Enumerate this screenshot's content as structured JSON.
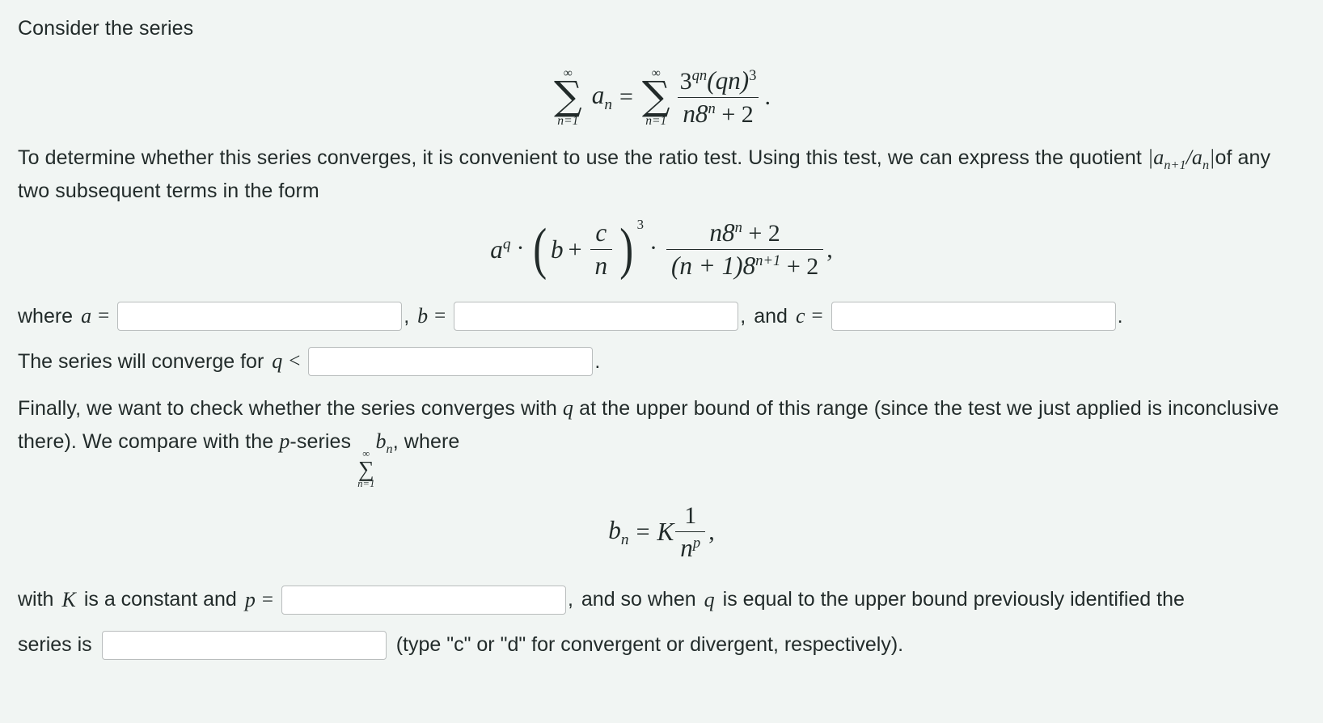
{
  "problem": {
    "intro": "Consider the series",
    "series_display": {
      "sum_limit_top": "∞",
      "sum_limit_bottom": "n=1",
      "term_symbol": "a",
      "term_index": "n",
      "equals": "=",
      "numerator_base": "3",
      "numerator_exponent": "qn",
      "numerator_paren": "(qn)",
      "numerator_paren_power": "3",
      "denominator": "n8",
      "denominator_exponent": "n",
      "denominator_tail": "+ 2",
      "trailing_punct": "."
    },
    "paragraph_ratio_test_1": "To determine whether this series converges, it is convenient to use the ratio test. Using this test, we can express the quotient",
    "paragraph_ratio_test_quotient_left": "|",
    "paragraph_ratio_test_quotient_a1": "a",
    "paragraph_ratio_test_quotient_sub1": "n+1",
    "paragraph_ratio_test_quotient_slash": "/",
    "paragraph_ratio_test_quotient_a2": "a",
    "paragraph_ratio_test_quotient_sub2": "n",
    "paragraph_ratio_test_quotient_right": "|",
    "paragraph_ratio_test_2": "of any two subsequent terms in the form",
    "quotient_display": {
      "a": "a",
      "a_exp": "q",
      "dot1": "·",
      "paren_open": "(",
      "b": "b",
      "plus": "+",
      "c": "c",
      "over_n": "n",
      "paren_close": ")",
      "paren_power": "3",
      "dot2": "·",
      "frac_num_n8": "n8",
      "frac_num_exp": "n",
      "frac_num_tail": "+ 2",
      "frac_den_paren": "(n + 1)8",
      "frac_den_exp": "n+1",
      "frac_den_tail": "+ 2",
      "trailing_punct": ","
    },
    "answers_line_1": {
      "where_label": "where",
      "a_symbol": "a",
      "a_equals": "=",
      "a_value": "",
      "comma_1": ",",
      "b_symbol": "b",
      "b_equals": "=",
      "b_value": "",
      "comma_2": ",",
      "and_label": "and",
      "c_symbol": "c",
      "c_equals": "=",
      "c_value": "",
      "period": "."
    },
    "converge_line": {
      "text": "The series will converge for",
      "q_symbol": "q",
      "less_than": "<",
      "q_value": "",
      "period": "."
    },
    "paragraph_final_1": "Finally, we want to check whether the series converges with",
    "paragraph_final_q": "q",
    "paragraph_final_2": "at the upper bound of this range (since the test we just applied is inconclusive there). We compare with the",
    "paragraph_final_p": "p",
    "paragraph_final_3": "-series",
    "pseries_inline": {
      "top": "∞",
      "bottom": "n=1",
      "term": "b",
      "term_index": "n",
      "comma": ","
    },
    "paragraph_final_4": "where",
    "bn_display": {
      "b": "b",
      "b_index": "n",
      "equals": "=",
      "K": "K",
      "frac_num": "1",
      "frac_den": "n",
      "frac_den_exp": "p",
      "trailing_punct": ","
    },
    "answers_line_2": {
      "with_label": "with",
      "K_symbol": "K",
      "is_constant_label": "is a constant and",
      "p_symbol": "p",
      "p_equals": "=",
      "p_value": "",
      "comma": ",",
      "tail_1": "and so when",
      "q_symbol": "q",
      "tail_2": "is equal to the upper bound previously identified the"
    },
    "answers_line_3": {
      "series_is_label": "series is",
      "series_value": "",
      "hint": "(type \"c\" or \"d\" for convergent or divergent, respectively)."
    }
  },
  "colors": {
    "background": "#f1f5f3",
    "text": "#222b2a",
    "input_border": "#b9bdbd",
    "input_background": "#ffffff"
  }
}
